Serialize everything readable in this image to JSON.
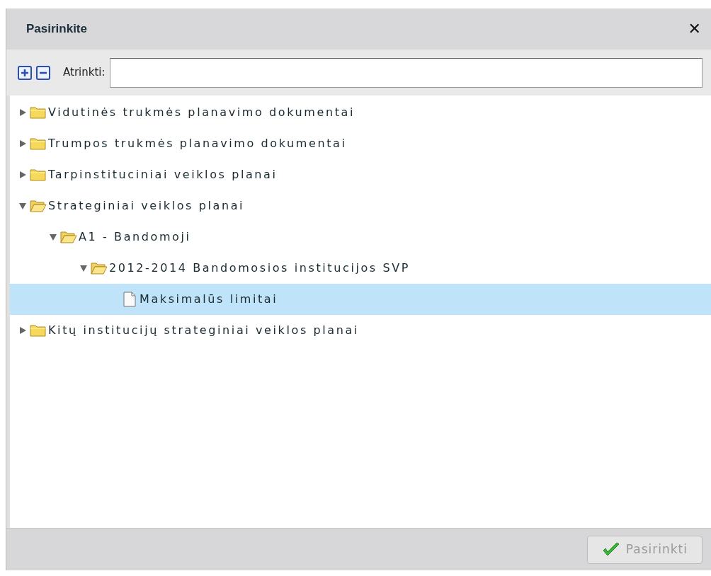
{
  "dialog": {
    "title": "Pasirinkite",
    "close": "✕"
  },
  "toolbar": {
    "filter_label": "Atrinkti:"
  },
  "tree": [
    {
      "label": "Vidutinės trukmės planavimo dokumentai",
      "kind": "folder",
      "expanded": false,
      "selected": false
    },
    {
      "label": "Trumpos trukmės planavimo dokumentai",
      "kind": "folder",
      "expanded": false,
      "selected": false
    },
    {
      "label": "Tarpinstituciniai veiklos planai",
      "kind": "folder",
      "expanded": false,
      "selected": false
    },
    {
      "label": "Strateginiai veiklos planai",
      "kind": "folder",
      "expanded": true,
      "selected": false,
      "children": [
        {
          "label": "A1 - Bandomoji",
          "kind": "folder",
          "expanded": true,
          "selected": false,
          "children": [
            {
              "label": "2012-2014 Bandomosios institucijos SVP",
              "kind": "folder",
              "expanded": true,
              "selected": false,
              "children": [
                {
                  "label": "Maksimalūs limitai",
                  "kind": "document",
                  "selected": true
                }
              ]
            }
          ]
        }
      ]
    },
    {
      "label": "Kitų institucijų strateginiai veiklos planai",
      "kind": "folder",
      "expanded": false,
      "selected": false
    }
  ],
  "footer": {
    "button": {
      "label": "Pasirinkti",
      "disabled": true
    }
  }
}
